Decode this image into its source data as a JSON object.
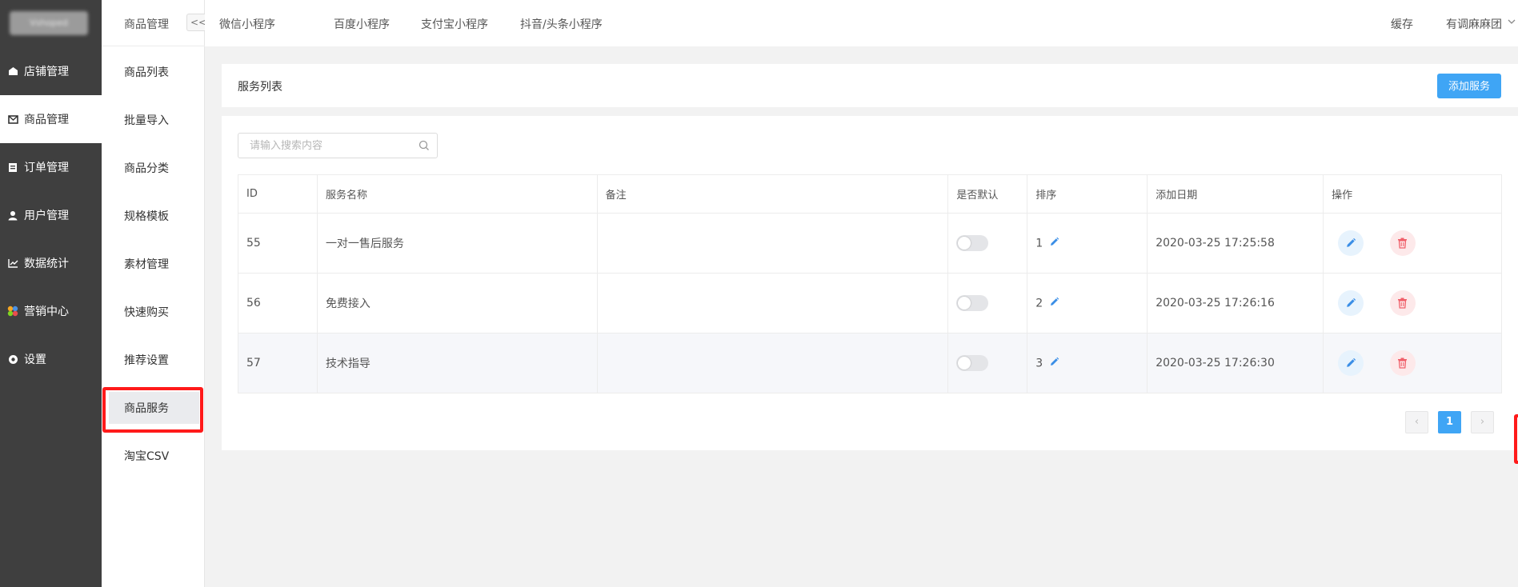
{
  "brand": {
    "logo_text": "Vshoped"
  },
  "sidebar": {
    "items": [
      {
        "label": "店铺管理",
        "icon": "store-icon"
      },
      {
        "label": "商品管理",
        "icon": "goods-icon"
      },
      {
        "label": "订单管理",
        "icon": "order-icon"
      },
      {
        "label": "用户管理",
        "icon": "user-icon"
      },
      {
        "label": "数据统计",
        "icon": "chart-icon"
      },
      {
        "label": "营销中心",
        "icon": "marketing-icon"
      },
      {
        "label": "设置",
        "icon": "gear-icon"
      }
    ],
    "active": "商品管理"
  },
  "submenu": {
    "title": "商品管理",
    "collapse_label": "<<",
    "items": [
      "商品列表",
      "批量导入",
      "商品分类",
      "规格模板",
      "素材管理",
      "快速购买",
      "推荐设置",
      "商品服务",
      "淘宝CSV"
    ],
    "selected": "商品服务"
  },
  "topbar": {
    "tabs": [
      "微信小程序",
      "百度小程序",
      "支付宝小程序",
      "抖音/头条小程序"
    ],
    "cache": "缓存",
    "account": "有调麻麻团"
  },
  "main": {
    "title": "服务列表",
    "add_button": "添加服务",
    "search_placeholder": "请输入搜索内容",
    "columns": [
      "ID",
      "服务名称",
      "备注",
      "是否默认",
      "排序",
      "添加日期",
      "操作"
    ],
    "rows": [
      {
        "id": "55",
        "name": "一对一售后服务",
        "remark": "",
        "default": false,
        "sort": "1",
        "date": "2020-03-25 17:25:58"
      },
      {
        "id": "56",
        "name": "免费接入",
        "remark": "",
        "default": false,
        "sort": "2",
        "date": "2020-03-25 17:26:16"
      },
      {
        "id": "57",
        "name": "技术指导",
        "remark": "",
        "default": false,
        "sort": "3",
        "date": "2020-03-25 17:26:30"
      }
    ],
    "pagination": {
      "prev": "‹",
      "current": "1",
      "next": "›"
    }
  },
  "colors": {
    "accent": "#3fa5f5",
    "sidebar_bg": "#3f3f3f",
    "danger": "#f0606a",
    "highlight_box": "#ff1a1a"
  }
}
